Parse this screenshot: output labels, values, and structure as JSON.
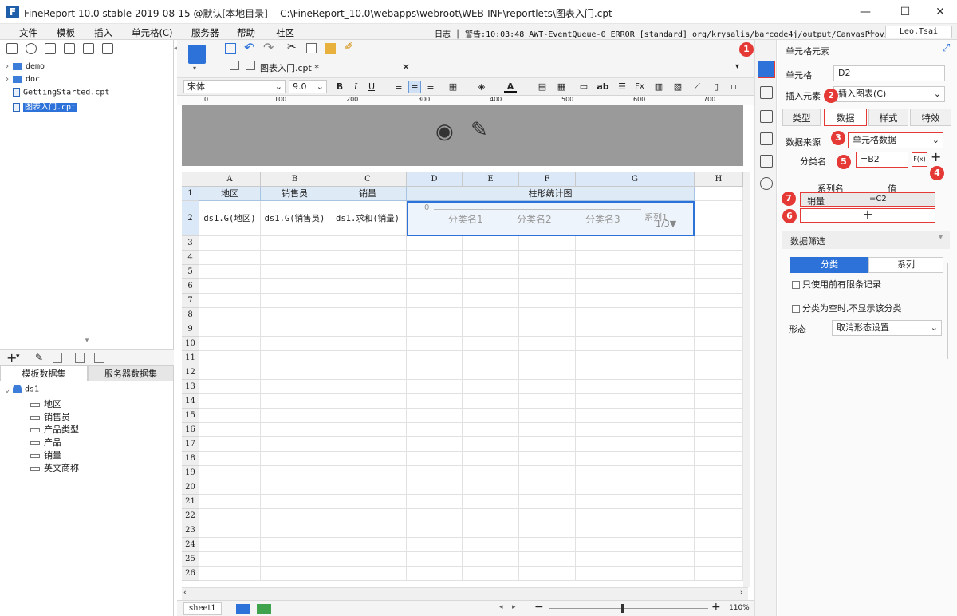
{
  "app": {
    "title": "FineReport 10.0 stable 2019-08-15 @默认[本地目录]",
    "path": "C:\\FineReport_10.0\\webapps\\webroot\\WEB-INF\\reportlets\\图表入门.cpt",
    "logo_letter": "F"
  },
  "window": {
    "minimize": "—",
    "maximize": "☐",
    "close": "✕"
  },
  "menu": [
    "文件",
    "模板",
    "插入",
    "单元格(C)",
    "服务器",
    "帮助",
    "社区"
  ],
  "status": {
    "log": "日志 │ 警告:10:03:48 AWT-EventQueue-0 ERROR [standard] org/krysalis/barcode4j/output/CanvasProvider",
    "user": "Leo.Tsai"
  },
  "tree": {
    "items": [
      {
        "label": "demo",
        "type": "folder"
      },
      {
        "label": "doc",
        "type": "folder"
      },
      {
        "label": "GettingStarted.cpt",
        "type": "file"
      },
      {
        "label": "图表入门.cpt",
        "type": "file",
        "selected": true
      }
    ]
  },
  "datasets": {
    "tabs": [
      "模板数据集",
      "服务器数据集"
    ],
    "name": "ds1",
    "fields": [
      "地区",
      "销售员",
      "产品类型",
      "产品",
      "销量",
      "英文商称"
    ]
  },
  "editor": {
    "tab_label": "图表入门.cpt *",
    "font": "宋体",
    "font_size": "9.0",
    "ruler": [
      "0",
      "100",
      "200",
      "300",
      "400",
      "500",
      "600",
      "700"
    ],
    "columns": [
      "A",
      "B",
      "C",
      "D",
      "E",
      "F",
      "G",
      "H"
    ],
    "rows": [
      "1",
      "2",
      "3",
      "4",
      "5",
      "6",
      "7",
      "8",
      "9",
      "10",
      "11",
      "12",
      "13",
      "14",
      "15",
      "16",
      "17",
      "18",
      "19",
      "20",
      "21",
      "22",
      "23",
      "24",
      "25",
      "26"
    ],
    "header_cells": {
      "a": "地区",
      "b": "销售员",
      "c": "销量",
      "dg": "柱形统计图"
    },
    "row2_cells": {
      "a": "ds1.G(地区)",
      "b": "ds1.G(销售员)",
      "c": "ds1.求和(销量)"
    },
    "chart": {
      "zero": "0",
      "categories": [
        "分类名1",
        "分类名2",
        "分类名3"
      ],
      "legend": "系列1",
      "pager": "1/3▼"
    },
    "sheet": "sheet1",
    "zoom": "110%"
  },
  "panel": {
    "title": "单元格元素",
    "cell_label": "单元格",
    "cell_value": "D2",
    "insert_label": "插入元素",
    "insert_value": "插入图表(C)",
    "tabs": [
      "类型",
      "数据",
      "样式",
      "特效"
    ],
    "source_label": "数据来源",
    "source_value": "单元格数据",
    "category_label": "分类名",
    "category_value": "=B2",
    "fx": "F(x)",
    "plus": "+",
    "series_header": "系列名",
    "value_header": "值",
    "series_row": {
      "name": "销量",
      "value": "=C2"
    },
    "add": "+",
    "filter_title": "数据筛选",
    "filter_tabs": [
      "分类",
      "系列"
    ],
    "opt1": "只使用前有限条记录",
    "opt2": "分类为空时,不显示该分类",
    "shape_label": "形态",
    "shape_value": "取消形态设置",
    "badges": [
      "1",
      "2",
      "3",
      "4",
      "5",
      "6",
      "7"
    ]
  },
  "colors": {
    "accent": "#2d72d9",
    "badge": "#e53935",
    "header_cell": "#dfeaf7"
  }
}
